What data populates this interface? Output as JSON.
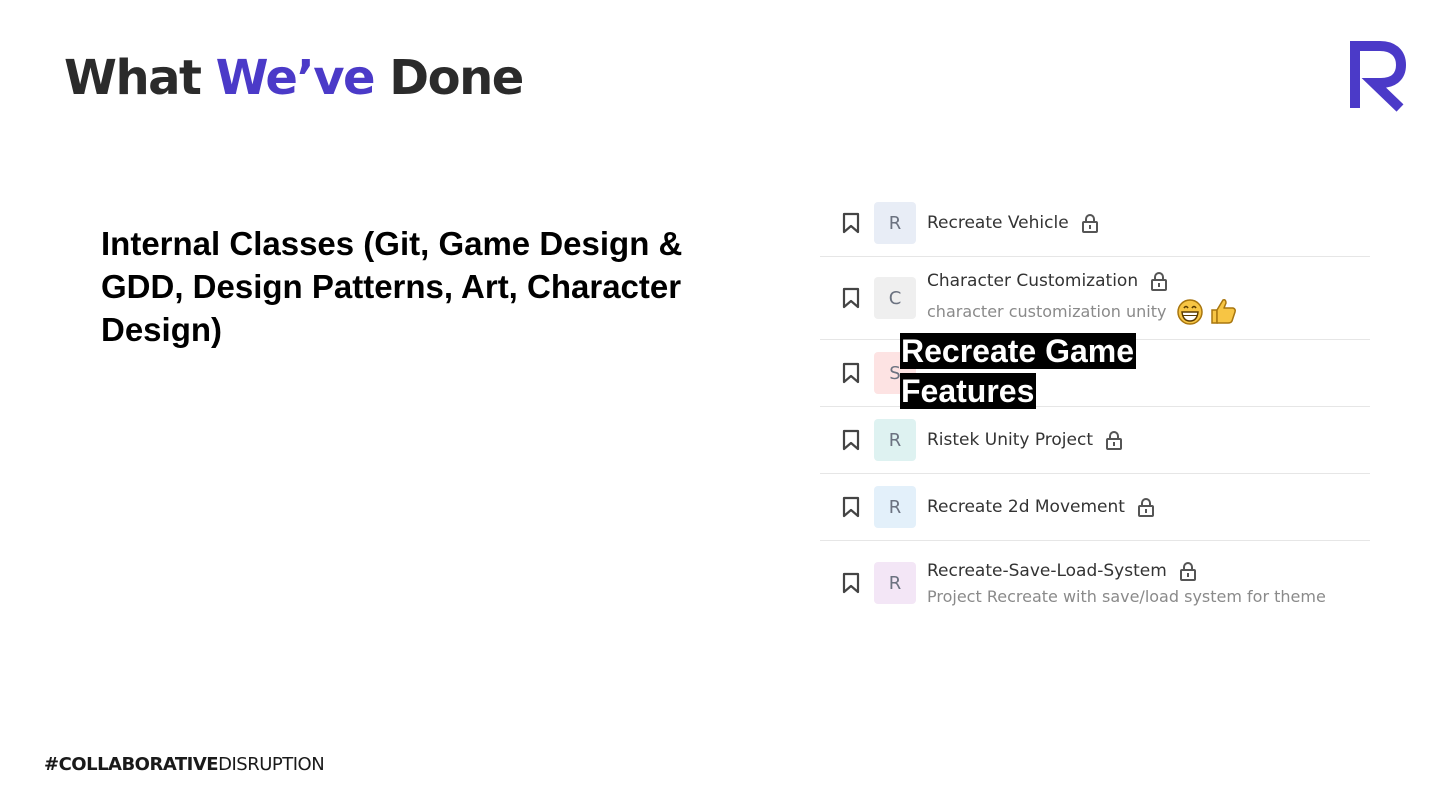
{
  "header": {
    "title_part1": "What",
    "title_accent": "We’ve",
    "title_part2": "Done",
    "accent_color": "#4b3ac8",
    "logo_icon": "r-logo-icon"
  },
  "body": {
    "text": "Internal Classes (Git, Game Design & GDD, Design Patterns, Art, Character Design)"
  },
  "overlay": {
    "line1": "Recreate Game",
    "line2": "Features"
  },
  "repos": [
    {
      "initial": "R",
      "name": "Recreate Vehicle",
      "avatar_color": "#e8edf6",
      "icon": "lock-icon"
    },
    {
      "initial": "C",
      "name": "Character Customization",
      "description": "character customization unity",
      "emoji": [
        "grinning-face-icon",
        "thumbs-up-icon"
      ],
      "avatar_color": "#efefef",
      "icon": "lock-icon"
    },
    {
      "initial": "S",
      "avatar_color": "#fde3e3"
    },
    {
      "initial": "R",
      "name": "Ristek Unity Project",
      "avatar_color": "#def2f1",
      "icon": "lock-icon"
    },
    {
      "initial": "R",
      "name": "Recreate 2d Movement",
      "avatar_color": "#e3f0fa",
      "icon": "lock-icon"
    },
    {
      "initial": "R",
      "name": "Recreate-Save-Load-System",
      "description": "Project Recreate with save/load system for theme",
      "avatar_color": "#f3e6f6",
      "icon": "lock-icon"
    }
  ],
  "footer": {
    "bold": "#COLLABORATIVE",
    "regular": "DISRUPTION"
  }
}
